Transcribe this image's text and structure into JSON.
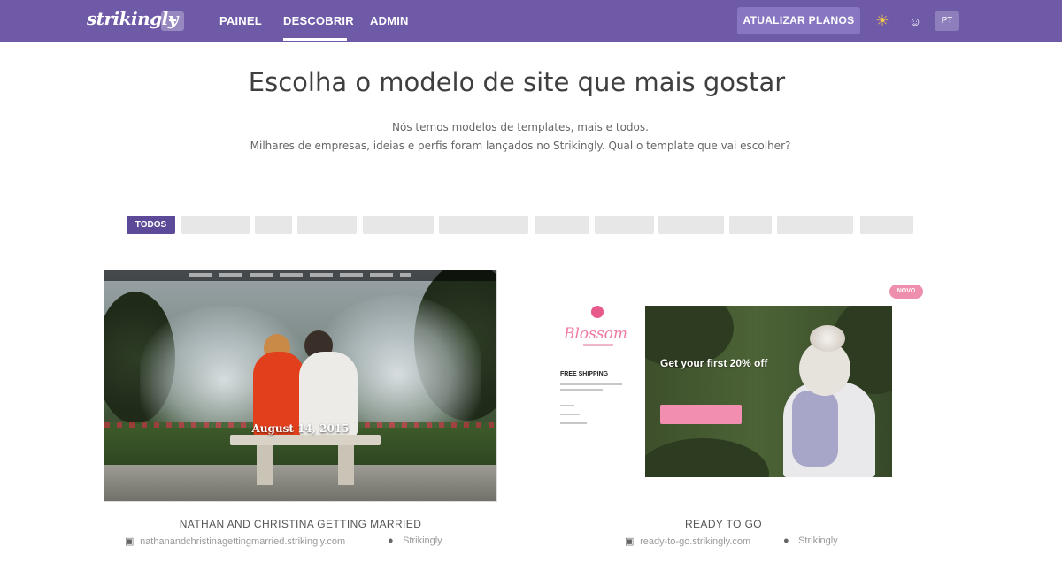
{
  "header": {
    "logo": "strikingly",
    "logo_badge": "✚",
    "nav": [
      {
        "label": "PAINEL",
        "active": false
      },
      {
        "label": "DESCOBRIR",
        "active": true
      },
      {
        "label": "ADMIN",
        "active": false
      }
    ],
    "upgrade_label": "ATUALIZAR PLANOS",
    "lang": "PT",
    "colors": {
      "bar": "#6f5aa8",
      "upgrade": "#8876c2",
      "chip_active": "#5c4a98"
    }
  },
  "main": {
    "title": "Escolha o modelo de site que mais gostar",
    "subtitle_1": "Nós temos modelos de templates, mais e todos.",
    "subtitle_2": "Milhares de empresas, ideias e perfis foram lançados no Strikingly. Qual o template que vai escolher?"
  },
  "categories": [
    {
      "label": "TODOS",
      "active": true
    },
    {
      "label": "",
      "active": false
    },
    {
      "label": "",
      "active": false
    },
    {
      "label": "",
      "active": false
    },
    {
      "label": "",
      "active": false
    },
    {
      "label": "",
      "active": false
    },
    {
      "label": "",
      "active": false
    },
    {
      "label": "",
      "active": false
    },
    {
      "label": "",
      "active": false
    },
    {
      "label": "",
      "active": false
    },
    {
      "label": "",
      "active": false
    },
    {
      "label": "",
      "active": false
    }
  ],
  "templates": [
    {
      "preview_text": "August 14, 2015",
      "name": "NATHAN AND CHRISTINA GETTING MARRIED",
      "url": "nathanandchristinagettingmarried.strikingly.com",
      "author": "Strikingly"
    },
    {
      "preview_logo": "Blossom",
      "preview_shipping": "FREE SHIPPING",
      "preview_promo": "Get your first 20% off",
      "badge": "NOVO",
      "name": "READY TO GO",
      "url": "ready-to-go.strikingly.com",
      "author": "Strikingly"
    }
  ]
}
